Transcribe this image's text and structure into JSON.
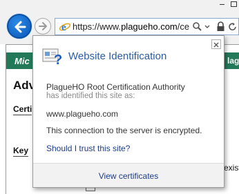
{
  "browser": {
    "address": {
      "prefix": "https://www.",
      "host": "plagueho.com",
      "suffix": "/cert"
    }
  },
  "page": {
    "banner_left": "Mic",
    "banner_right": "lagu",
    "heading": "Adv",
    "section_cert": "Certi",
    "section_key": "Key",
    "exist_text": "exist"
  },
  "popup": {
    "title": "Website Identification",
    "authority": "PlagueHO Root Certification Authority",
    "identified_text": "has identified this site as:",
    "site": "www.plagueho.com",
    "encrypted_text": "This connection to the server is encrypted.",
    "trust_link": "Should I trust this site?",
    "view_certificates": "View certificates"
  }
}
